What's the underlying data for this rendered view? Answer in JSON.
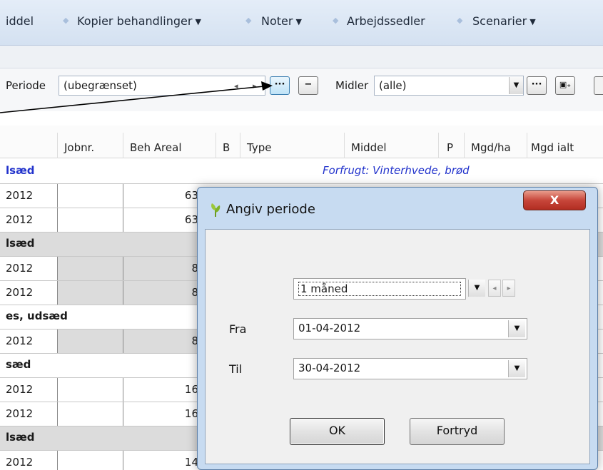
{
  "menubar": {
    "items": [
      {
        "label": "iddel",
        "dropdown": false
      },
      {
        "label": "Kopier behandlinger",
        "dropdown": true
      },
      {
        "label": "Noter",
        "dropdown": true
      },
      {
        "label": "Arbejdssedler",
        "dropdown": false
      },
      {
        "label": "Scenarier",
        "dropdown": true
      }
    ],
    "dropdown_glyph": "▼",
    "separator_glyph": "◆"
  },
  "filter": {
    "periode_label": "Periode",
    "periode_value": "(ubegrænset)",
    "nav_prev": "◂",
    "nav_next": "▸",
    "ellipsis": "···",
    "minus": "−",
    "midler_label": "Midler",
    "midler_value": "(alle)",
    "combo_arrow": "▼",
    "add_icon": "▣₊"
  },
  "grid": {
    "columns": [
      "Jobnr.",
      "Beh Areal",
      "B",
      "Type",
      "Middel",
      "P",
      "Mgd/ha",
      "Mgd ialt"
    ],
    "rows": [
      {
        "kind": "group",
        "text": "lsæd",
        "note": "Forfrugt: Vinterhvede, brød"
      },
      {
        "kind": "data",
        "date": "2012",
        "area": "63",
        "shade": false
      },
      {
        "kind": "data",
        "date": "2012",
        "area": "63",
        "shade": false
      },
      {
        "kind": "group",
        "text": "lsæd",
        "note": "",
        "shade": true
      },
      {
        "kind": "data",
        "date": "2012",
        "area": "8",
        "shade": true
      },
      {
        "kind": "data",
        "date": "2012",
        "area": "8",
        "shade": true
      },
      {
        "kind": "group",
        "text": "es, udsæd",
        "note": ""
      },
      {
        "kind": "data",
        "date": "2012",
        "area": "8",
        "shade": true
      },
      {
        "kind": "group",
        "text": "sæd",
        "note": ""
      },
      {
        "kind": "data",
        "date": "2012",
        "area": "16",
        "shade": false
      },
      {
        "kind": "data",
        "date": "2012",
        "area": "16",
        "shade": false
      },
      {
        "kind": "group",
        "text": "lsæd",
        "note": "",
        "shade": true
      },
      {
        "kind": "data",
        "date": "2012",
        "area": "14",
        "shade": false
      }
    ]
  },
  "dialog": {
    "title": "Angiv periode",
    "close_glyph": "X",
    "period_select": "1 måned",
    "fra_label": "Fra",
    "fra_value": "01-04-2012",
    "til_label": "Til",
    "til_value": "30-04-2012",
    "ok_label": "OK",
    "cancel_label": "Fortryd",
    "spin_left": "◂",
    "spin_right": "▸",
    "combo_arrow": "▼"
  },
  "colors": {
    "menubar_bg": "#d4e1f1",
    "forfrugt_text": "#2233cc",
    "dialog_frame": "#c7dbf1",
    "close_button": "#c7463a",
    "shaded_row": "#dcdcdc"
  }
}
